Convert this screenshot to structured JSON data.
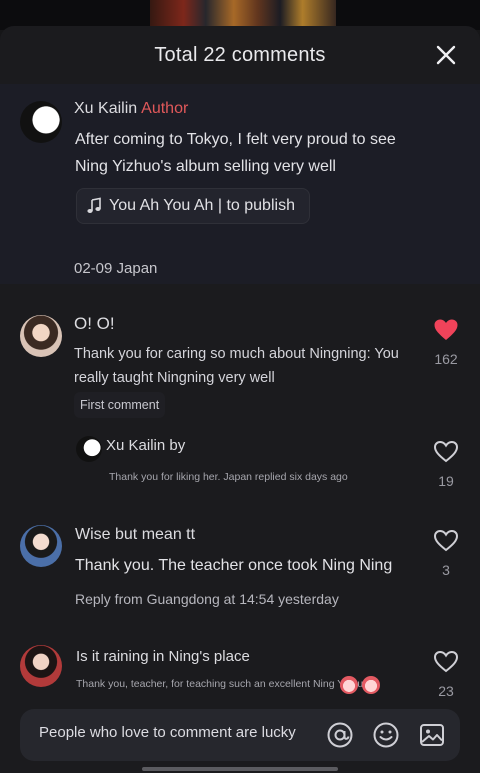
{
  "header": {
    "title": "Total 22 comments",
    "close_icon": "close-icon"
  },
  "author_post": {
    "name": "Xu Kailin",
    "badge": "Author",
    "text": "After coming to Tokyo, I felt very proud to see Ning Yizhuo's album selling very well",
    "music_chip": "You Ah You Ah | to publish",
    "meta": "02-09 Japan"
  },
  "comments": [
    {
      "name": "O! O!",
      "text": "Thank you for caring so much about Ningning: You really taught Ningning very well",
      "overlay": "Ning",
      "tag": "First comment",
      "likes": "162",
      "liked": true,
      "reply": {
        "name": "Xu Kailin by",
        "text": "Thank you for liking her. Japan replied six days ago",
        "likes": "19"
      }
    },
    {
      "name": "Wise but mean tt",
      "text": "Thank you. The teacher once took Ning Ning",
      "meta": "Reply from Guangdong at 14:54 yesterday",
      "likes": "3"
    },
    {
      "name": "Is it raining in Ning's place",
      "text": "Thank you, teacher, for teaching such an excellent Ning Yizhuo",
      "likes": "23"
    }
  ],
  "composer": {
    "placeholder": "People who love to comment are lucky",
    "icons": [
      "at-icon",
      "emoji-icon",
      "image-icon"
    ]
  },
  "colors": {
    "accent_red": "#e0585a",
    "heart_liked": "#f0435a",
    "background": "#1b1b1e"
  }
}
